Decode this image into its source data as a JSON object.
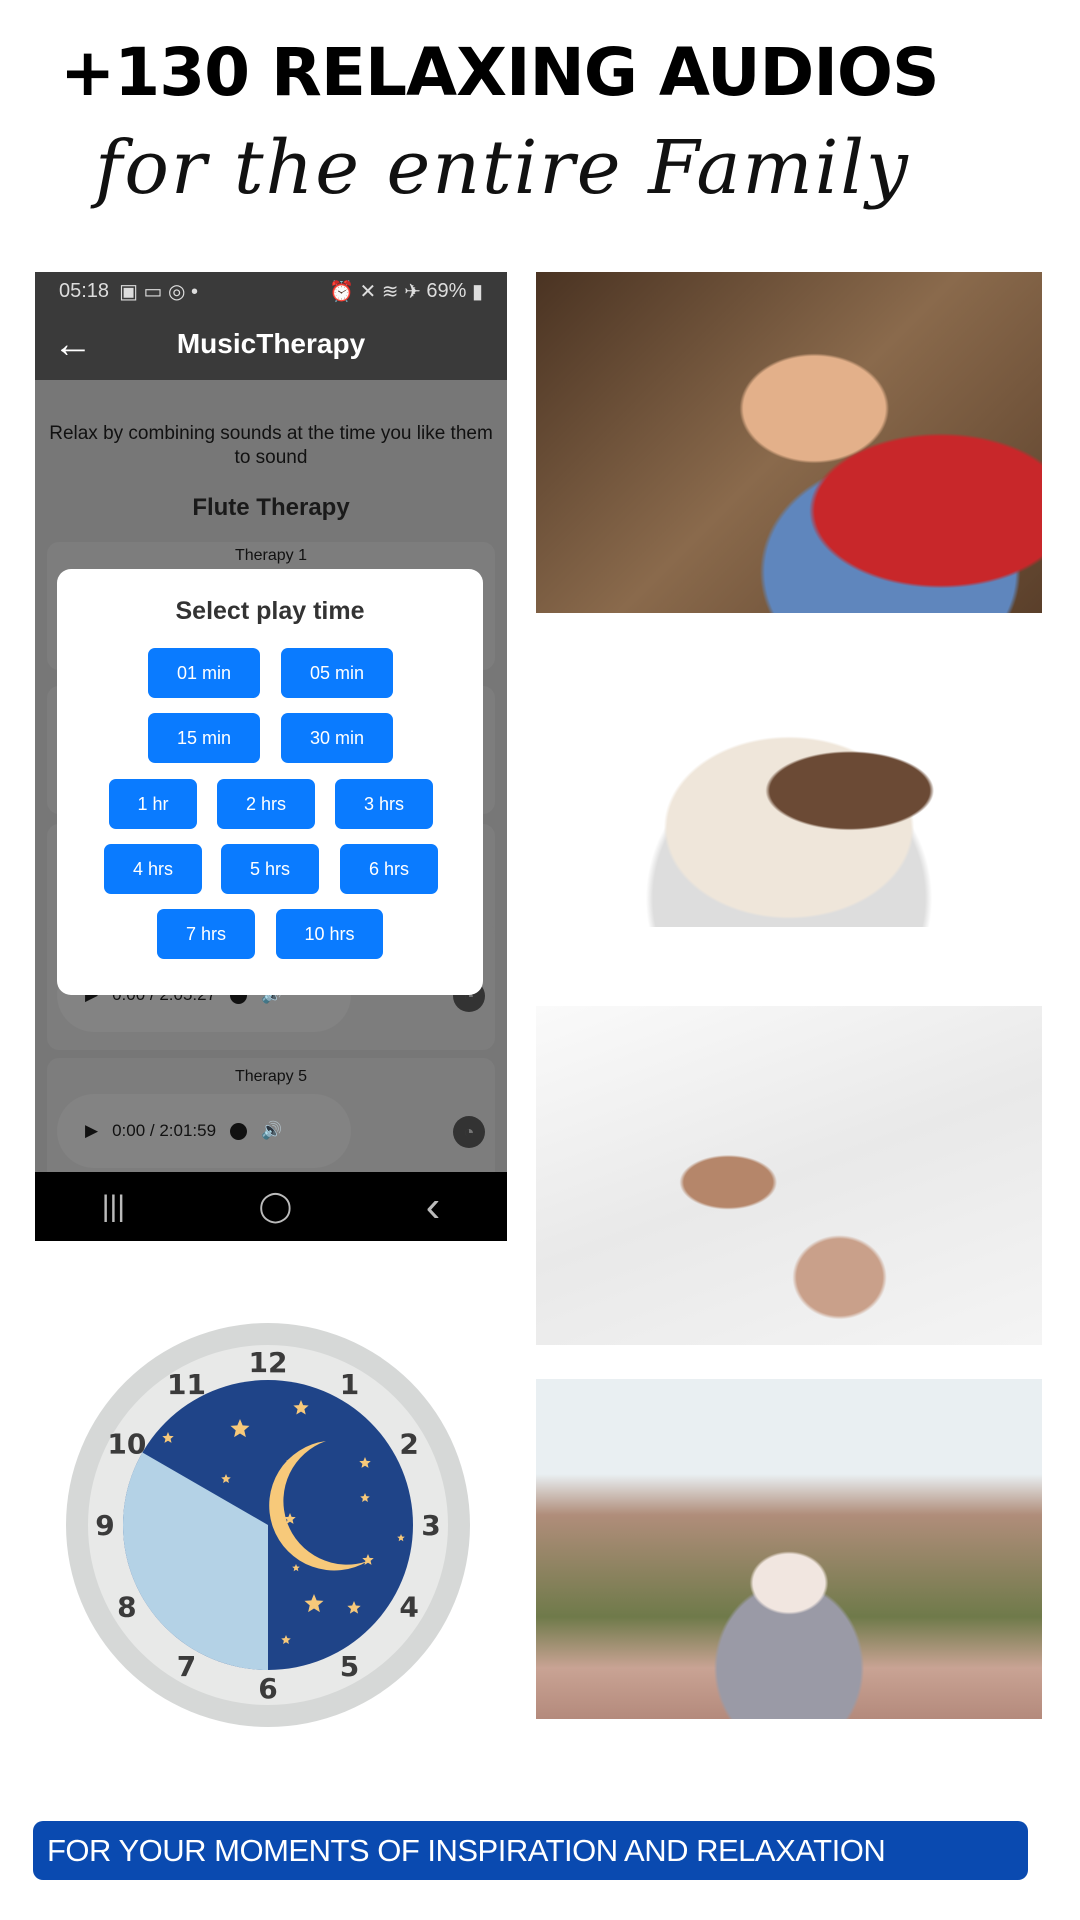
{
  "headline": "+130 RELAXING AUDIOS",
  "script_line": "for the entire Family",
  "phone": {
    "status": {
      "time": "05:18",
      "icons_left": [
        "app-icon",
        "laptop-icon",
        "instagram-icon",
        "dot"
      ],
      "icons_right": [
        "alarm-icon",
        "mute-icon",
        "wifi-icon",
        "airplane-icon"
      ],
      "battery": "69%"
    },
    "app_title": "MusicTherapy",
    "description": "Relax by combining sounds at the time you like them to sound",
    "section_title": "Flute Therapy",
    "tracks": [
      {
        "label": "Therapy 1",
        "time": ""
      },
      {
        "label": "",
        "time": ""
      },
      {
        "label": "",
        "time": ""
      },
      {
        "label": "",
        "time": "0:00 / 2:05:27"
      },
      {
        "label": "Therapy 5",
        "time": "0:00 / 2:01:59"
      }
    ],
    "dialog": {
      "title": "Select play time",
      "options": [
        "01 min",
        "05 min",
        "15 min",
        "30 min",
        "1 hr",
        "2 hrs",
        "3 hrs",
        "4 hrs",
        "5 hrs",
        "6 hrs",
        "7 hrs",
        "10 hrs"
      ]
    },
    "nav": {
      "recents": "|||",
      "home": "◯",
      "back": "‹"
    }
  },
  "clock": {
    "numbers": [
      "12",
      "1",
      "2",
      "3",
      "4",
      "5",
      "6",
      "7",
      "8",
      "9",
      "10",
      "11"
    ],
    "colors": {
      "night": "#1f4488",
      "day": "#b4d2e6",
      "ring": "#e8e9e8",
      "outer": "#d6d8d7",
      "star": "#f7c97a"
    }
  },
  "photos": [
    "sleeping-child",
    "french-bulldog",
    "sleeping-man",
    "meditating-woman"
  ],
  "banner": "FOR YOUR MOMENTS OF INSPIRATION AND RELAXATION",
  "colors": {
    "button": "#0a7bff",
    "banner": "#0a4ab0"
  }
}
